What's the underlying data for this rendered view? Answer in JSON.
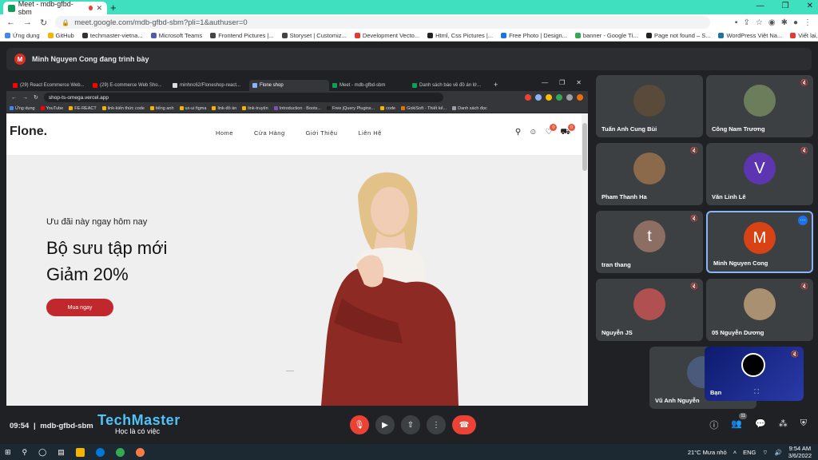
{
  "outer_browser": {
    "tab_title": "Meet - mdb-gfbd-sbm",
    "url": "meet.google.com/mdb-gfbd-sbm?pli=1&authuser=0",
    "bookmarks": [
      "Ứng dụng",
      "GitHub",
      "techmaster-vietna...",
      "Microsoft Teams",
      "Frontend Pictures |...",
      "Storyset | Customiz...",
      "Development Vecto...",
      "Html, Css Pictures |...",
      "Free Photo | Design...",
      "banner - Google Tì...",
      "Page not found – S...",
      "WordPress Việt Na...",
      "Viết lại, viết lại họcer..."
    ]
  },
  "presenting": {
    "avatar_letter": "M",
    "text": "Minh Nguyen Cong đang trình bày"
  },
  "inner_browser": {
    "tabs": [
      "(29) React Ecommerce Web...",
      "(29) E-commerce Web Sho...",
      "minhnc62/Floneshop-react...",
      "Flone shop",
      "Meet - mdb-gfbd-sbm",
      "Danh sách báo về đồ án lớ..."
    ],
    "url": "shop-ts-omega.vercel.app",
    "bookmarks": [
      "Ứng dụng",
      "YouTube",
      "FE-REACT",
      "link-kiến thức code",
      "tiếng anh",
      "ux-ui figma",
      "link-đồ án",
      "link-truyện",
      "Introduction · Boots...",
      "Free jQuery Plugins...",
      "code",
      "GokiSoft - Thiết kế...",
      "Danh sách đọc"
    ]
  },
  "site": {
    "logo": "Flone.",
    "menu": [
      "Home",
      "Cửa Hàng",
      "Giới Thiệu",
      "Liên Hệ"
    ],
    "wishlist_count": "0",
    "cart_count": "0",
    "hero_subtitle": "Ưu đãi này ngay hôm nay",
    "hero_title_line1": "Bộ sưu tập mới",
    "hero_title_line2": "Giảm 20%",
    "hero_button": "Mua ngay"
  },
  "participants": [
    {
      "name": "Tuấn Anh Cung Bùi",
      "type": "photo",
      "color": "#5a4a3a",
      "muted": false
    },
    {
      "name": "Công Nam Trương",
      "type": "photo",
      "color": "#6b7d5a",
      "muted": true
    },
    {
      "name": "Pham Thanh Ha",
      "type": "photo",
      "color": "#8a6a4a",
      "muted": true
    },
    {
      "name": "Văn Linh Lê",
      "type": "letter",
      "letter": "V",
      "color": "#5e35b1",
      "muted": true
    },
    {
      "name": "tran thang",
      "type": "letter",
      "letter": "t",
      "color": "#8d6e63",
      "muted": true
    },
    {
      "name": "Minh Nguyen Cong",
      "type": "letter",
      "letter": "M",
      "color": "#d84315",
      "muted": false
    },
    {
      "name": "Nguyễn JS",
      "type": "photo",
      "color": "#b05050",
      "muted": true
    },
    {
      "name": "05 Nguyễn Dương",
      "type": "photo",
      "color": "#a89070",
      "muted": true
    },
    {
      "name": "Vũ Anh Nguyễn",
      "type": "photo",
      "color": "#4a5a7a",
      "muted": false
    },
    {
      "name": "Bạn",
      "type": "self",
      "muted": true
    }
  ],
  "meeting": {
    "time": "09:54",
    "code": "mdb-gfbd-sbm",
    "participant_count": "11"
  },
  "watermark": {
    "brand": "TechMaster",
    "tagline": "Học là có việc"
  },
  "taskbar": {
    "weather": "21°C  Mưa nhỏ",
    "lang": "ENG",
    "time": "9:54 AM",
    "date": "3/6/2022"
  }
}
